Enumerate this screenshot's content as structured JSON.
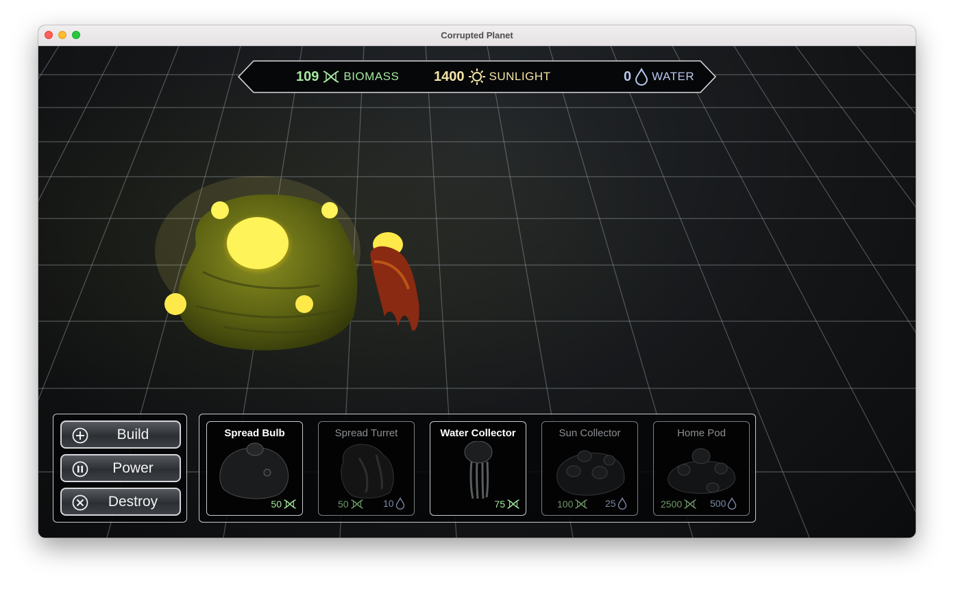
{
  "window": {
    "title": "Corrupted Planet"
  },
  "hud": {
    "biomass": {
      "value": "109",
      "label": "BIOMASS",
      "icon": "dna-icon",
      "color": "#a6e8a0"
    },
    "sunlight": {
      "value": "1400",
      "label": "SUNLIGHT",
      "icon": "sun-icon",
      "color": "#f5e6a8"
    },
    "water": {
      "value": "0",
      "label": "WATER",
      "icon": "water-drop-icon",
      "color": "#b9c7ef"
    }
  },
  "actions": {
    "build": {
      "label": "Build",
      "icon": "plus-circle-icon"
    },
    "power": {
      "label": "Power",
      "icon": "pause-circle-icon"
    },
    "destroy": {
      "label": "Destroy",
      "icon": "x-circle-icon"
    }
  },
  "cards": [
    {
      "name": "Spread Bulb",
      "biomass_cost": "50",
      "water_cost": null,
      "available": true
    },
    {
      "name": "Spread Turret",
      "biomass_cost": "50",
      "water_cost": "10",
      "available": false
    },
    {
      "name": "Water Collector",
      "biomass_cost": "75",
      "water_cost": null,
      "available": true
    },
    {
      "name": "Sun Collector",
      "biomass_cost": "100",
      "water_cost": "25",
      "available": false
    },
    {
      "name": "Home Pod",
      "biomass_cost": "2500",
      "water_cost": "500",
      "available": false
    }
  ],
  "colors": {
    "biomass_text": "#a6e8a0",
    "biomass_dim": "#6f9a6b",
    "water_dim": "#7d8aa8",
    "hud_frame": "#d7dadd"
  }
}
